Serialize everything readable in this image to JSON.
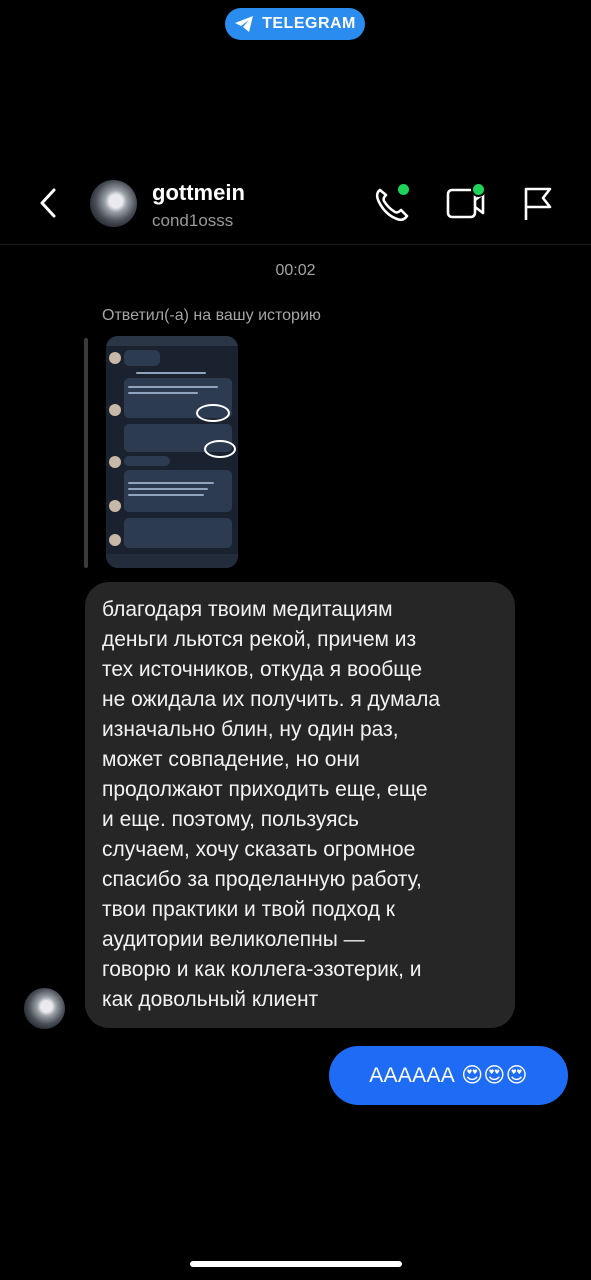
{
  "badge": {
    "label": "TELEGRAM",
    "icon": "telegram-plane-icon"
  },
  "header": {
    "name": "gottmein",
    "username": "cond1osss",
    "icons": [
      "back-chevron-icon",
      "phone-icon",
      "video-icon",
      "flag-icon"
    ],
    "online_color": "#1ed35a"
  },
  "conversation": {
    "time": "00:02",
    "reply_note": "Ответил(-а) на вашу историю",
    "incoming_text": "благодаря твоим медитациям\nденьги льются рекой, причем из\nтех источников, откуда я вообще\nне ожидала их получить. я думала\nизначально блин, ну один раз,\nможет совпадение, но они\nпродолжают приходить еще, еще\nи еще. поэтому, пользуясь\nслучаем, хочу сказать огромное\nспасибо за проделанную работу,\nтвои практики и твой подход к\nаудитории великолепны —\nговорю и как коллега-эзотерик, и\nкак довольный клиент",
    "outgoing_text": "АААААА 😍😍😍"
  },
  "colors": {
    "incoming_bubble": "#262626",
    "outgoing_bubble": "#1e6cf5",
    "badge": "#2b8cf0"
  }
}
